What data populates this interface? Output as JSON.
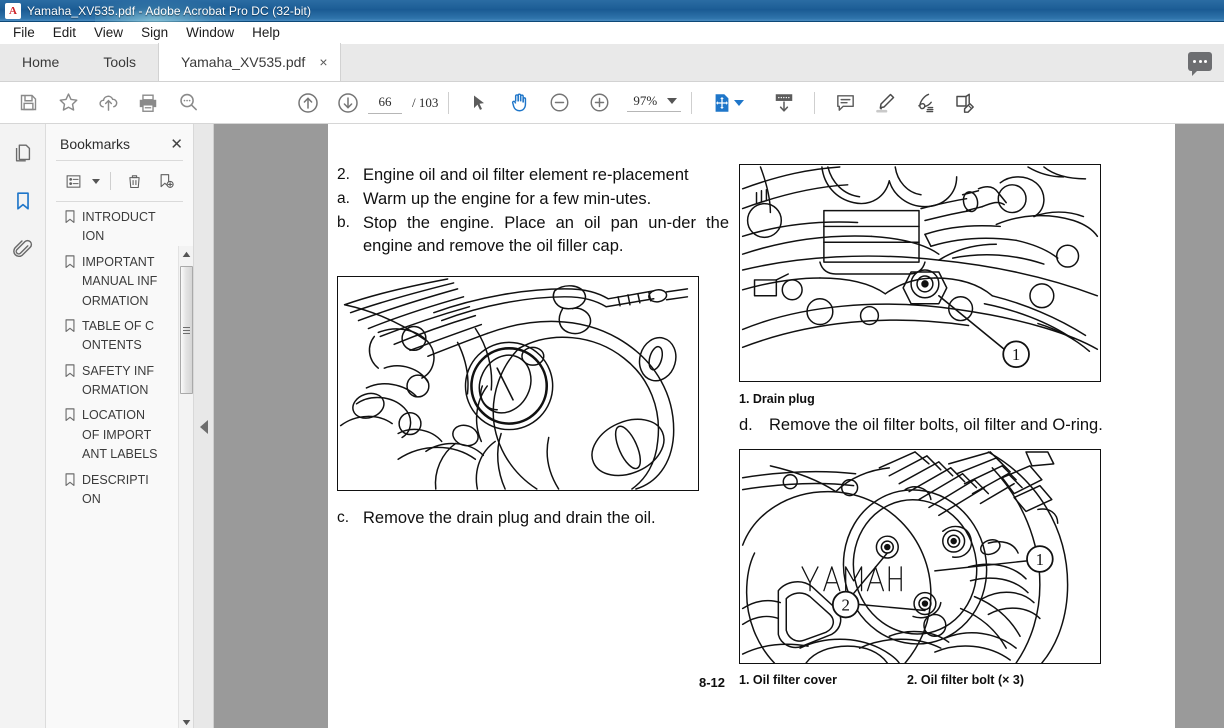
{
  "window": {
    "title": "Yamaha_XV535.pdf - Adobe Acrobat Pro DC (32-bit)",
    "app_icon": "A"
  },
  "menu": {
    "items": [
      "File",
      "Edit",
      "View",
      "Sign",
      "Window",
      "Help"
    ]
  },
  "tabs": {
    "home": "Home",
    "tools": "Tools",
    "document": "Yamaha_XV535.pdf",
    "close": "×"
  },
  "toolbar": {
    "icons": [
      "save-icon",
      "star-icon",
      "cloud-upload-icon",
      "print-icon",
      "search-icon",
      "page-up-icon",
      "page-down-icon",
      "select-cursor-icon",
      "hand-tool-icon",
      "zoom-out-icon",
      "zoom-in-icon",
      "fit-page-icon",
      "scroll-mode-icon",
      "comment-icon",
      "highlighter-icon",
      "sign-icon",
      "edit-pdf-icon"
    ],
    "page_current": "66",
    "page_total": "/ 103",
    "zoom_level": "97%"
  },
  "sidebar": {
    "rail": [
      "page-thumbnails-icon",
      "bookmarks-icon",
      "attachments-icon"
    ],
    "panel_title": "Bookmarks",
    "tools": [
      "options-list-icon",
      "delete-bookmark-icon",
      "new-bookmark-icon"
    ],
    "bookmarks": [
      "INTRODUCTION",
      "IMPORTANT MANUAL INFORMATION",
      "TABLE OF CONTENTS",
      "SAFETY INFORMATION",
      "LOCATION OF IMPORTANT LABELS",
      "DESCRIPTION"
    ]
  },
  "document": {
    "page_number": "8-12",
    "left_column": {
      "steps": [
        {
          "marker": "2.",
          "text": "Engine oil and oil filter element re-placement"
        },
        {
          "marker": "a.",
          "text": "Warm up the engine for a few min-utes."
        },
        {
          "marker": "b.",
          "text": "Stop the engine. Place an oil pan un-der the engine and remove the oil filler cap."
        }
      ],
      "figure_alt": "Engine crankcase cover with oil filler cap - line drawing",
      "step_c": {
        "marker": "c.",
        "text": "Remove the drain plug and drain the oil."
      }
    },
    "right_column": {
      "figure1_alt": "Engine underside with drain plug - line drawing",
      "figure1_callout": "1",
      "caption1": "1.  Drain plug",
      "step_d": {
        "marker": "d.",
        "text": "Remove the oil filter bolts, oil filter and O-ring."
      },
      "figure2_alt": "Engine oil filter cover with YAMAHA branding - line drawing",
      "figure2_brand": "YAMAHA",
      "figure2_callouts": [
        "1",
        "2"
      ],
      "caption2a": "1.  Oil filter cover",
      "caption2b": "2.  Oil filter bolt (× 3)"
    }
  },
  "colors": {
    "accent_blue": "#1f76c9",
    "titlebar_blue": "#1d5e96",
    "doc_background": "#9a9a9a",
    "panel_grey": "#f3f3f3"
  }
}
